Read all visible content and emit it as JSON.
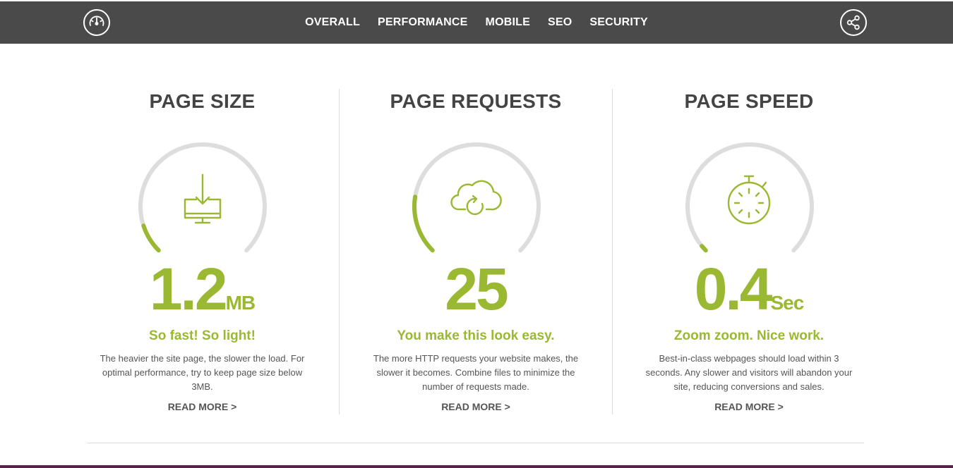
{
  "nav": {
    "items": [
      "OVERALL",
      "PERFORMANCE",
      "MOBILE",
      "SEO",
      "SECURITY"
    ]
  },
  "icons": {
    "logo": "speedometer-icon",
    "share": "share-icon"
  },
  "colors": {
    "accent": "#9ab832",
    "topbar": "#4a4a4a",
    "gauge_track": "#dddddd",
    "footer": "#5a2146"
  },
  "cards": [
    {
      "title": "PAGE SIZE",
      "value": "1.2",
      "unit": "MB",
      "gauge_fraction": 0.1,
      "icon": "download-monitor-icon",
      "tagline": "So fast! So light!",
      "description": "The heavier the site page, the slower the load. For optimal performance, try to keep page size below 3MB.",
      "link": "READ MORE >"
    },
    {
      "title": "PAGE REQUESTS",
      "value": "25",
      "unit": "",
      "gauge_fraction": 0.2,
      "icon": "cloud-refresh-icon",
      "tagline": "You make this look easy.",
      "description": "The more HTTP requests your website makes, the slower it becomes. Combine files to minimize the number of requests made.",
      "link": "READ MORE >"
    },
    {
      "title": "PAGE SPEED",
      "value": "0.4",
      "unit": "Sec",
      "gauge_fraction": 0.02,
      "icon": "stopwatch-icon",
      "tagline": "Zoom zoom. Nice work.",
      "description": "Best-in-class webpages should load within 3 seconds. Any slower and visitors will abandon your site, reducing conversions and sales.",
      "link": "READ MORE >"
    }
  ]
}
